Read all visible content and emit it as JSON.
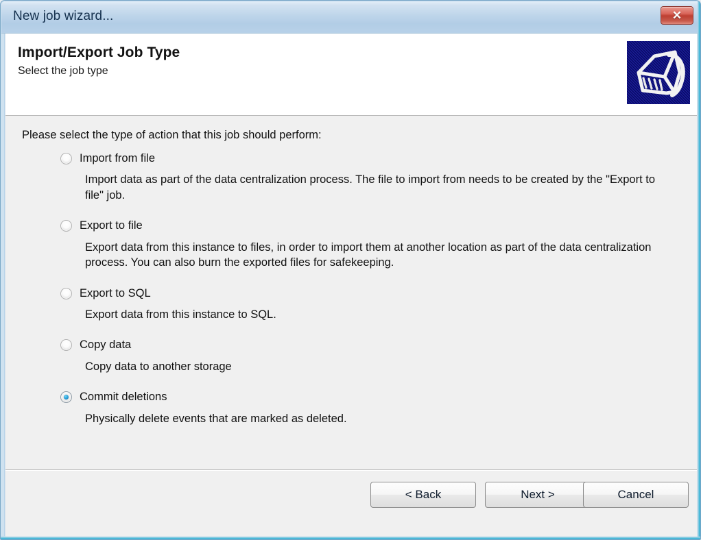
{
  "window": {
    "title": "New job wizard...",
    "close_label": "✕",
    "close_icon": "close-icon"
  },
  "header": {
    "title": "Import/Export Job Type",
    "subtitle": "Select the job type",
    "icon": "import-export-job-icon",
    "icon_bg": "#090a66"
  },
  "body": {
    "intro": "Please select the type of action that this job should perform:",
    "options": [
      {
        "label": "Import from file",
        "description": "Import data as part of the data centralization process. The file to import from needs to be created by the \"Export to file\" job.",
        "selected": false
      },
      {
        "label": "Export to file",
        "description": "Export data from this instance to files, in order to import them at another location as part of the data centralization process. You can also burn the exported files for safekeeping.",
        "selected": false
      },
      {
        "label": "Export to SQL",
        "description": "Export data from this instance to SQL.",
        "selected": false
      },
      {
        "label": "Copy data",
        "description": "Copy data to another storage",
        "selected": false
      },
      {
        "label": "Commit deletions",
        "description": "Physically delete events that are marked as deleted.",
        "selected": true
      }
    ]
  },
  "footer": {
    "back_label": "< Back",
    "next_label": "Next >",
    "cancel_label": "Cancel"
  },
  "colors": {
    "titlebar_top": "#e3eef8",
    "titlebar_bottom": "#b7d1e8",
    "client_bg": "#f0f0f0",
    "header_bg": "#ffffff",
    "close_red": "#bd3f32",
    "radio_accent": "#1372b4",
    "frame_glow": "#2aa9cf"
  }
}
